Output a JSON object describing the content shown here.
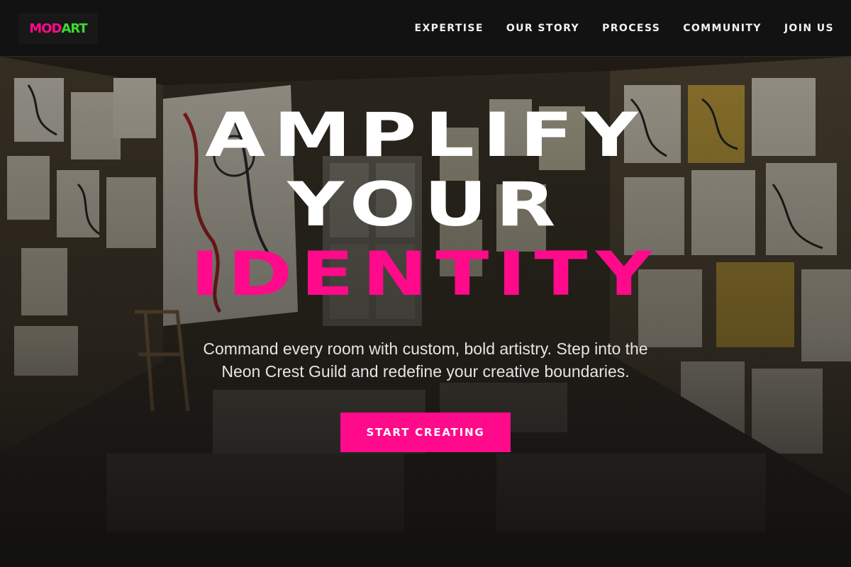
{
  "brand": {
    "logo_part1": "MOD",
    "logo_part2": "ART",
    "color_part1": "#ff0a8a",
    "color_part2": "#3ddc2e"
  },
  "nav": {
    "items": [
      {
        "label": "EXPERTISE"
      },
      {
        "label": "OUR STORY"
      },
      {
        "label": "PROCESS"
      },
      {
        "label": "COMMUNITY"
      },
      {
        "label": "JOIN US"
      }
    ]
  },
  "hero": {
    "headline_line1": "AMPLIFY",
    "headline_line2": "YOUR",
    "headline_line3": "IDENTITY",
    "subtitle": "Command every room with custom, bold artistry. Step into the Neon Crest Guild and redefine your creative boundaries.",
    "cta_label": "START CREATING",
    "accent_color": "#ff0a8a",
    "background_image": "art-studio-room-photo"
  }
}
